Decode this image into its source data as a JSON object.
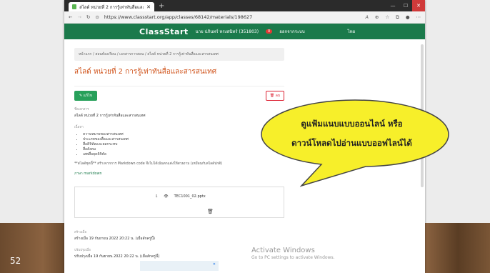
{
  "tab": {
    "title": "สไลด์ หน่วยที่ 2 การรู้เท่าทันสื่อและสารสนเทศ"
  },
  "address": {
    "url": "https://www.classstart.org/app/classes/68142/materials/198627"
  },
  "site": {
    "logo": "ClassStart",
    "user": "นาย ปภินทร์ ทรงสนิทร์ (351803)",
    "logout": "ออกจากระบบ",
    "lang": "ไทย"
  },
  "breadcrumb": "หน้าแรก / สอนห้องเรียน / เอกสารการสอน / สไลด์ หน่วยที่ 2 การรู้เท่าทันสื่อและสารสนเทศ",
  "page": {
    "title": "สไลด์ หน่วยที่ 2 การรู้เท่าทันสื่อและสารสนเทศ",
    "edit_label": "แก้ไข",
    "delete_label": "ลบ",
    "name_label": "ชื่อเอกสาร",
    "name_value": "สไลด์ หน่วยที่ 2 การรู้เท่าทันสื่อและสารสนเทศ",
    "desc_label": "เนื้อหา",
    "bullets": [
      "ความหมายของสารสนเทศ",
      "ประเภทของสื่อและสารสนเทศ",
      "สื่อดิจิทัลและผลกระทบ",
      "สื่อสังคม",
      "เสพสื่อยุคดิจิทัล"
    ],
    "note": "**สไลด์ชุดนี้** สร้างจากการ Markdown code จึงไม่ได้เน้นตกแต่งให้สวยงาม (เหมือนกับสไลด์ปกติ)",
    "markdown_link": "ภาษา markdown",
    "file_name": "TEC1001_02.pptx",
    "created_label": "สร้างเมื่อ",
    "created_value": "สร้างเมื่อ 19 กันยายน 2022 20:22 น. (เมื่อสักครู่นี้)",
    "updated_label": "ปรับปรุงเมื่อ",
    "updated_value": "ปรับปรุงเมื่อ 19 กันยายน 2022 20:22 น. (เมื่อสักครู่นี้)"
  },
  "watermark": {
    "line1": "Activate Windows",
    "line2": "Go to PC settings to activate Windows."
  },
  "callout": {
    "line1": "ดูแฟ้มแนบแบบออนไลน์ หรือ",
    "line2": "ดาวน์โหลดไปอ่านแบบออฟไลน์ได้",
    "fill": "#f7ef2a",
    "stroke": "#444444"
  },
  "slide": {
    "number": "52"
  }
}
